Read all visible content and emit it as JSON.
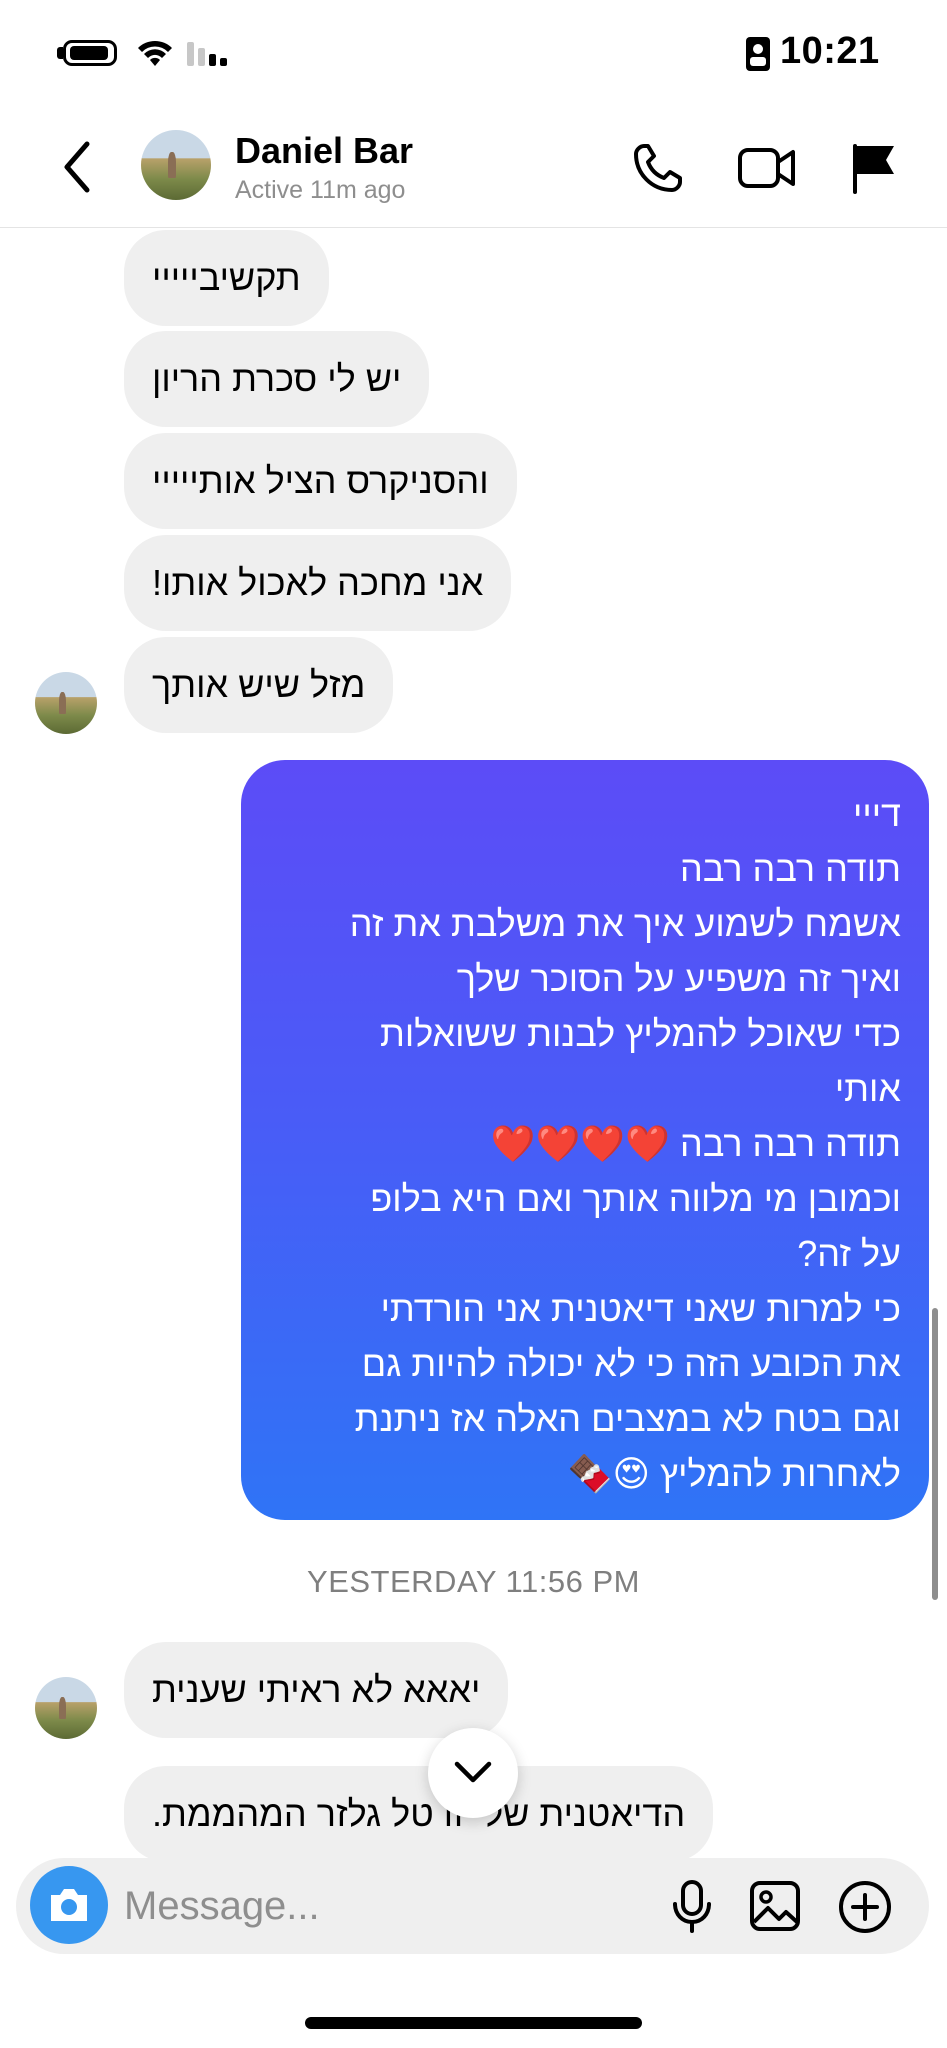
{
  "status_bar": {
    "time": "10:21"
  },
  "header": {
    "contact_name": "Daniel Bar",
    "activity": "Active 11m ago",
    "icons": [
      "back-arrow-icon",
      "phone-icon",
      "video-icon",
      "flag-icon"
    ]
  },
  "messages": {
    "incoming_top": [
      "תקשיבייייי",
      "יש לי סכרת הריון",
      "והסניקרס הציל אותייייי",
      "אני מחכה לאכול אותו!",
      "מזל שיש אותך"
    ],
    "outgoing_lines": [
      "דייי",
      "תודה רבה רבה",
      "אשמח לשמוע איך את משלבת את זה",
      "ואיך זה משפיע על הסוכר שלך",
      "כדי שאוכל להמליץ לבנות ששואלות",
      "אותי",
      "תודה רבה רבה ❤️❤️❤️❤️",
      "וכמובן מי מלווה אותך ואם היא בלופ",
      "על זה?",
      "כי למרות שאני דיאטנית אני הורדתי",
      "את הכובע הזה כי לא יכולה להיות גם",
      "וגם בטח לא במצבים האלה אז ניתנת",
      "לאחרות להמליץ 😍🍫"
    ],
    "timestamp": "YESTERDAY 11:56 PM",
    "incoming_bottom": [
      "יאאא לא ראיתי שענית",
      "הדיאטנית שלי זו טל גלזר המהממת."
    ]
  },
  "composer": {
    "placeholder": "Message...",
    "icons": [
      "camera-icon",
      "microphone-icon",
      "image-icon",
      "plus-icon"
    ]
  },
  "colors": {
    "outgoing_top": "#5c4cf7",
    "outgoing_bottom": "#2f74f6",
    "incoming_bg": "#efefef",
    "camera_button": "#3797f0"
  }
}
